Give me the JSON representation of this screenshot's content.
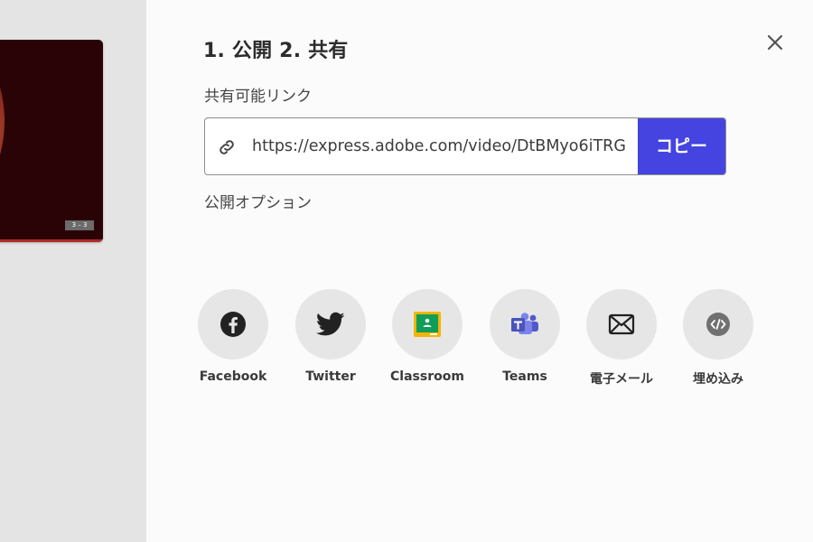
{
  "header": {
    "title": "1. 公開 2. 共有"
  },
  "thumbnail": {
    "badge": "3 – 3"
  },
  "share_link": {
    "label": "共有可能リンク",
    "url": "https://express.adobe.com/video/DtBMyo6iTRG",
    "copy_label": "コピー"
  },
  "publish_options": {
    "label": "公開オプション"
  },
  "share_targets": [
    {
      "label": "Facebook",
      "icon": "facebook-icon"
    },
    {
      "label": "Twitter",
      "icon": "twitter-icon"
    },
    {
      "label": "Classroom",
      "icon": "google-classroom-icon"
    },
    {
      "label": "Teams",
      "icon": "microsoft-teams-icon"
    },
    {
      "label": "電子メール",
      "icon": "email-icon"
    },
    {
      "label": "埋め込み",
      "icon": "embed-code-icon"
    }
  ],
  "colors": {
    "accent": "#4544e0",
    "left_pane": "#e4e4e4",
    "icon_circle": "#e6e6e6"
  }
}
